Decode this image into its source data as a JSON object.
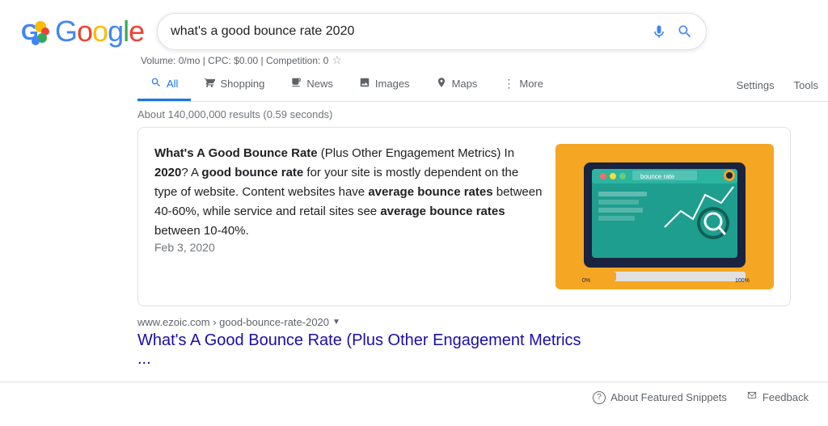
{
  "header": {
    "logo_alt": "Google",
    "search_query": "what's a good bounce rate 2020",
    "mic_icon": "🎤",
    "search_icon": "🔍"
  },
  "volume_bar": {
    "text": "Volume: 0/mo | CPC: $0.00 | Competition: 0",
    "star": "☆"
  },
  "tabs": [
    {
      "label": "All",
      "icon": "🔍",
      "active": true
    },
    {
      "label": "Shopping",
      "icon": "◇"
    },
    {
      "label": "News",
      "icon": "▦"
    },
    {
      "label": "Images",
      "icon": "▨"
    },
    {
      "label": "Maps",
      "icon": "⊙"
    },
    {
      "label": "More",
      "icon": "⋮"
    }
  ],
  "settings_label": "Settings",
  "tools_label": "Tools",
  "results_info": "About 140,000,000 results (0.59 seconds)",
  "snippet": {
    "title_bold": "What's A Good Bounce Rate",
    "title_rest": " (Plus Other Engagement Metrics) In ",
    "year_bold": "2020",
    "body_1": "? A ",
    "body_bold1": "good bounce rate",
    "body_2": " for your site is mostly dependent on the type of website. Content websites have ",
    "body_bold2": "average bounce rates",
    "body_3": " between 40-60%, while service and retail sites see ",
    "body_bold3": "average bounce rates",
    "body_4": " between 10-40%.",
    "date": "Feb 3, 2020"
  },
  "result_url": "www.ezoic.com › good-bounce-rate-2020",
  "result_title": "What's A Good Bounce Rate (Plus Other Engagement Metrics ...",
  "footer": {
    "about_label": "About Featured Snippets",
    "feedback_label": "Feedback",
    "question_icon": "?",
    "feedback_icon": "⚑"
  },
  "colors": {
    "active_blue": "#1a73e8",
    "link_purple": "#1a0dab",
    "snippet_bg": "#f5a623"
  }
}
